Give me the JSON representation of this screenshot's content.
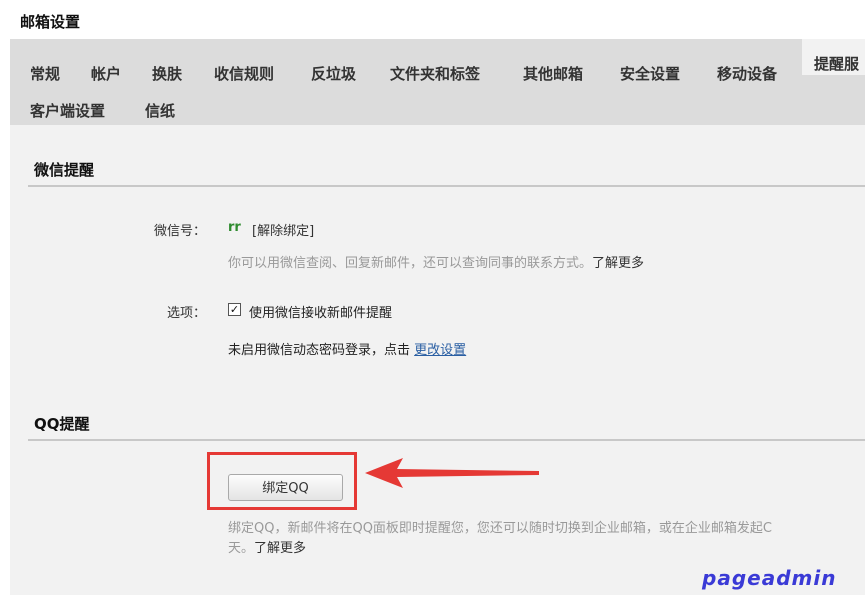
{
  "page_title": "邮箱设置",
  "tabs": [
    {
      "label": "常规"
    },
    {
      "label": "帐户"
    },
    {
      "label": "换肤"
    },
    {
      "label": "收信规则"
    },
    {
      "label": "反垃圾"
    },
    {
      "label": "文件夹和标签"
    },
    {
      "label": "其他邮箱"
    },
    {
      "label": "安全设置"
    },
    {
      "label": "移动设备"
    },
    {
      "label": "提醒服",
      "active": true
    },
    {
      "label": "客户端设置"
    },
    {
      "label": "信纸"
    }
  ],
  "wechat": {
    "section_title": "微信提醒",
    "id_label": "微信号：",
    "id_value": "rr",
    "unbind_link": "[解除绑定]",
    "hint": "你可以用微信查阅、回复新邮件，还可以查询同事的联系方式。",
    "learn_more": "了解更多",
    "options_label": "选项：",
    "checkbox_label": "使用微信接收新邮件提醒",
    "checkbox_checked": true,
    "dynamic_text": "未启用微信动态密码登录，点击",
    "change_link": "更改设置"
  },
  "qq": {
    "section_title": "QQ提醒",
    "bind_button": "绑定QQ",
    "desc_line1": "绑定QQ，新邮件将在QQ面板即时提醒您，您还可以随时切换到企业邮箱，或在企业邮箱发起C",
    "desc_line2": "天。",
    "learn_more": "了解更多"
  },
  "annotation": {
    "highlight_color": "#e53935"
  },
  "watermark": "pageadmin"
}
